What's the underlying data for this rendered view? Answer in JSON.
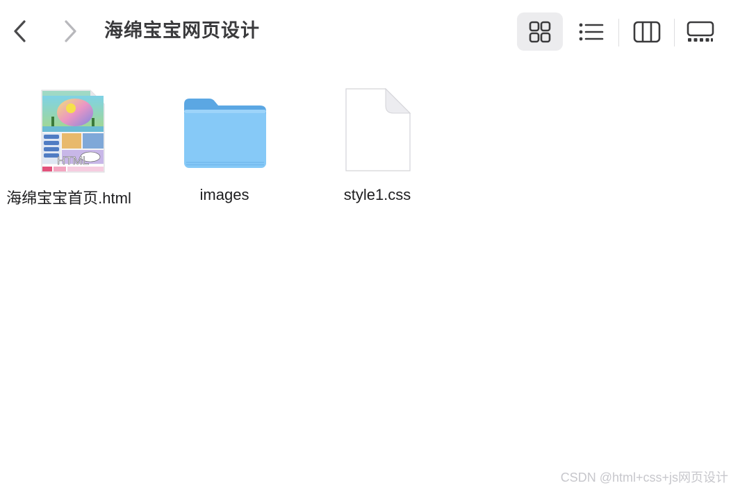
{
  "window": {
    "title": "海绵宝宝网页设计"
  },
  "toolbar": {
    "back_icon": "chevron-left-icon",
    "forward_icon": "chevron-right-icon",
    "views": [
      {
        "name": "icons",
        "icon": "grid-icon",
        "active": true
      },
      {
        "name": "list",
        "icon": "list-icon",
        "active": false
      },
      {
        "name": "columns",
        "icon": "columns-icon",
        "active": false
      },
      {
        "name": "gallery",
        "icon": "gallery-icon",
        "active": false
      }
    ]
  },
  "files": [
    {
      "name": "海绵宝宝首页.html",
      "kind": "html",
      "badge": "HTML"
    },
    {
      "name": "images",
      "kind": "folder"
    },
    {
      "name": "style1.css",
      "kind": "document"
    }
  ],
  "watermark": "CSDN @html+css+js网页设计",
  "colors": {
    "folder_body": "#86c9f7",
    "folder_tab": "#5ba7e3",
    "active_view_bg": "#ececee",
    "title_text": "#3a3a3c"
  }
}
